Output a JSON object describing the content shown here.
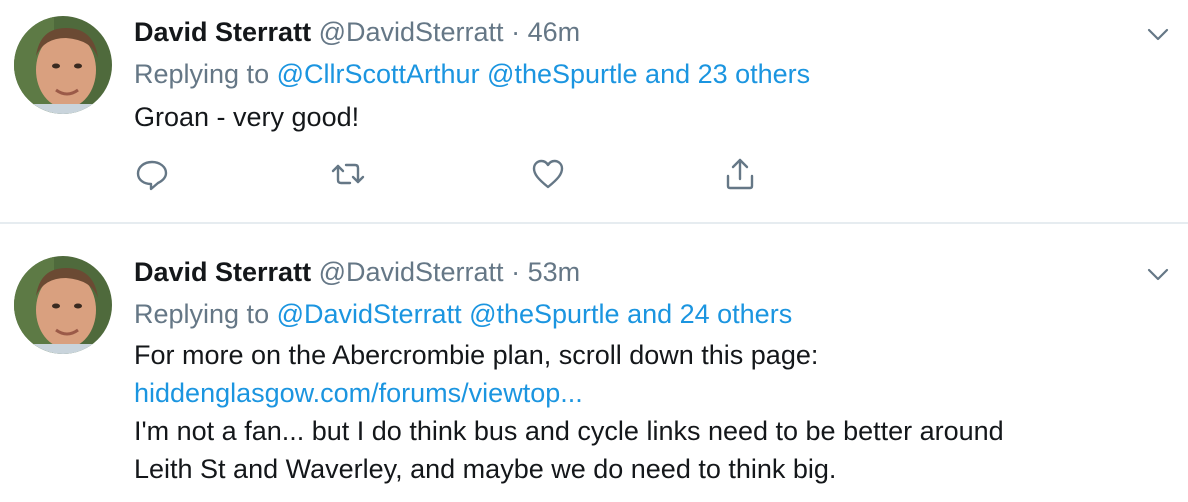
{
  "colors": {
    "text": "#14171a",
    "secondary": "#657786",
    "link": "#1b95e0",
    "divider": "#e6ecf0"
  },
  "tweets": [
    {
      "name": "David Sterratt",
      "handle": "@DavidSterratt",
      "separator": "·",
      "time": "46m",
      "replying_prefix": "Replying to",
      "replying_to": "@CllrScottArthur @theSpurtle and 23 others",
      "lines": [
        "Groan - very good!"
      ],
      "actions": [
        "reply-icon",
        "retweet-icon",
        "like-icon",
        "share-icon"
      ]
    },
    {
      "name": "David Sterratt",
      "handle": "@DavidSterratt",
      "separator": "·",
      "time": "53m",
      "replying_prefix": "Replying to",
      "replying_to": "@DavidSterratt @theSpurtle and 24 others",
      "lines": [
        "For more on the Abercrombie plan, scroll down this page:",
        "hiddenglasgow.com/forums/viewtop...",
        "I'm not a fan... but I do think bus and cycle links need to be better around",
        "Leith St and Waverley, and maybe we do need to think big."
      ]
    }
  ]
}
